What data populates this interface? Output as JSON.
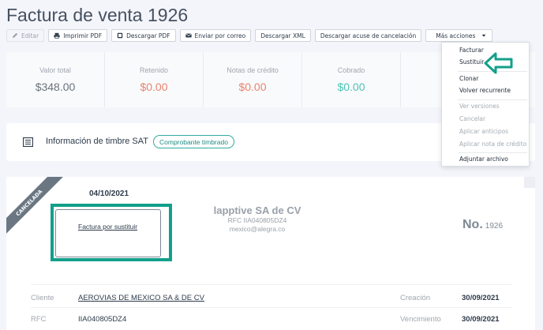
{
  "page": {
    "title": "Factura de venta 1926"
  },
  "toolbar": {
    "edit": "Editar",
    "print_pdf": "Imprimir PDF",
    "download_pdf": "Descargar PDF",
    "send_email": "Enviar por correo",
    "download_xml": "Descargar XML",
    "download_ack": "Descargar acuse de cancelación",
    "more_actions": "Más acciones"
  },
  "summary": {
    "items": [
      {
        "label": "Valor total",
        "value": "$348.00",
        "color": "#6b737c"
      },
      {
        "label": "Retenido",
        "value": "$0.00",
        "color": "#e8836d"
      },
      {
        "label": "Notas de crédito",
        "value": "$0.00",
        "color": "#e8836d"
      },
      {
        "label": "Cobrado",
        "value": "$0.00",
        "color": "#4cc3b4"
      }
    ]
  },
  "sat": {
    "title": "Información de timbre SAT",
    "badge": "Comprobante timbrado"
  },
  "invoice": {
    "ribbon": "CANCELADA",
    "date": "04/10/2021",
    "replace_link": "Factura por sustituir",
    "company_name": "lapptive SA de CV",
    "company_rfc": "RFC IIA040805DZ4",
    "company_email": "mexico@alegra.co",
    "number_prefix": "No.",
    "number": "1926",
    "rows": [
      {
        "label": "Cliente",
        "value": "AEROVIAS DE MEXICO SA & DE CV",
        "label2": "Creación",
        "value2": "30/09/2021"
      },
      {
        "label": "RFC",
        "value": "IIA040805DZ4",
        "label2": "Vencimiento",
        "value2": "30/09/2021"
      }
    ]
  },
  "menu": {
    "items": [
      {
        "label": "Facturar",
        "dim": false
      },
      {
        "label": "Sustituir",
        "dim": false
      },
      {
        "label": "Clonar",
        "dim": false
      },
      {
        "label": "Volver recurrente",
        "dim": false
      },
      {
        "label": "Ver versiones",
        "dim": true
      },
      {
        "label": "Cancelar",
        "dim": true
      },
      {
        "label": "Aplicar anticipos",
        "dim": true
      },
      {
        "label": "Aplicar nota de crédito",
        "dim": true
      },
      {
        "label": "Adjuntar archivo",
        "dim": false
      }
    ]
  },
  "colors": {
    "accent": "#139f8b",
    "negative": "#e8836d",
    "positive": "#4cc3b4"
  }
}
